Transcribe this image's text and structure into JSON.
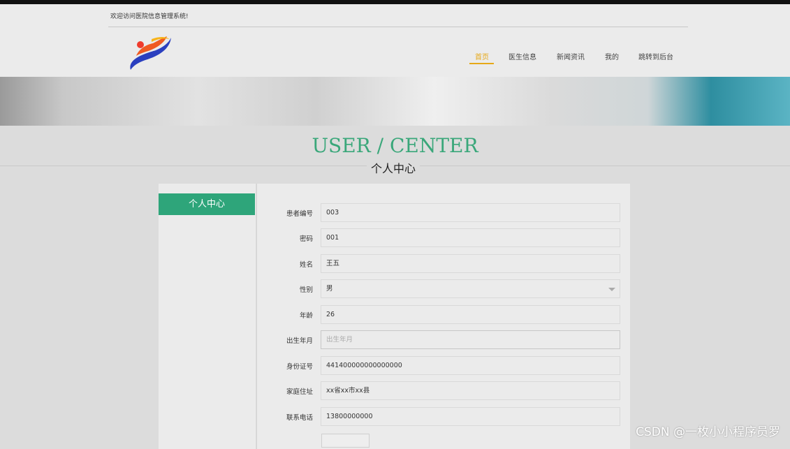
{
  "header": {
    "welcome": "欢迎访问医院信息管理系统!",
    "nav": [
      "首页",
      "医生信息",
      "新闻资讯",
      "我的",
      "跳转到后台"
    ],
    "active_nav": "首页"
  },
  "title": {
    "en": "USER / CENTER",
    "cn": "个人中心"
  },
  "sidebar": {
    "items": [
      "个人中心"
    ]
  },
  "form": {
    "fields": [
      {
        "label": "患者编号",
        "value": "003"
      },
      {
        "label": "密码",
        "value": "001"
      },
      {
        "label": "姓名",
        "value": "王五"
      },
      {
        "label": "性别",
        "value": "男"
      },
      {
        "label": "年龄",
        "value": "26"
      },
      {
        "label": "出生年月",
        "placeholder": "出生年月"
      },
      {
        "label": "身份证号",
        "value": "441400000000000000"
      },
      {
        "label": "家庭住址",
        "value": "xx省xx市xx县"
      },
      {
        "label": "联系电话",
        "value": "13800000000"
      }
    ]
  },
  "watermark": "CSDN @一枚小小程序员罗",
  "colors": {
    "accent": "#2ea57a",
    "nav_active": "#e6a817"
  }
}
